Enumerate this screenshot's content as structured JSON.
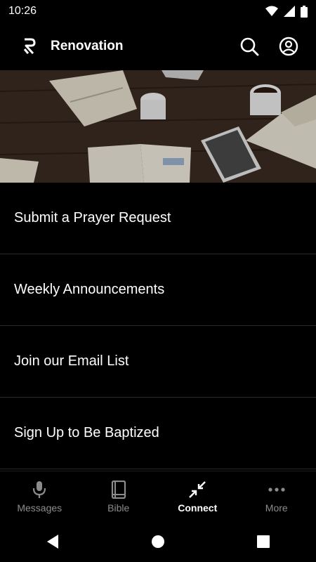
{
  "status_bar": {
    "time": "10:26"
  },
  "app_bar": {
    "title": "Renovation"
  },
  "menu_items": [
    {
      "label": "Submit a Prayer Request"
    },
    {
      "label": "Weekly Announcements"
    },
    {
      "label": "Join our Email List"
    },
    {
      "label": "Sign Up to Be Baptized"
    }
  ],
  "bottom_nav": {
    "items": [
      {
        "label": "Messages",
        "icon": "microphone-icon",
        "active": false
      },
      {
        "label": "Bible",
        "icon": "book-icon",
        "active": false
      },
      {
        "label": "Connect",
        "icon": "connect-arrows-icon",
        "active": true
      },
      {
        "label": "More",
        "icon": "more-dots-icon",
        "active": false
      }
    ]
  },
  "colors": {
    "background": "#000000",
    "text": "#ffffff",
    "inactive": "#8c8c8c",
    "divider": "#2a2a2a"
  }
}
